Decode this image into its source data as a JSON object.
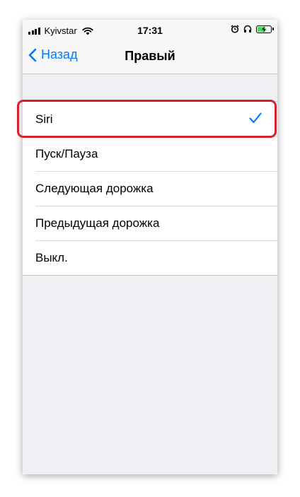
{
  "status_bar": {
    "carrier": "Kyivstar",
    "time": "17:31",
    "icons": [
      "signal-icon",
      "wifi-icon",
      "alarm-icon",
      "headphones-icon",
      "battery-charging-icon"
    ],
    "battery_color": "#4cd964"
  },
  "nav": {
    "back_label": "Назад",
    "title": "Правый",
    "accent_color": "#007aff"
  },
  "options": [
    {
      "label": "Siri",
      "selected": true
    },
    {
      "label": "Пуск/Пауза",
      "selected": false
    },
    {
      "label": "Следующая дорожка",
      "selected": false
    },
    {
      "label": "Предыдущая дорожка",
      "selected": false
    },
    {
      "label": "Выкл.",
      "selected": false
    }
  ],
  "highlight_color": "#d6202b"
}
